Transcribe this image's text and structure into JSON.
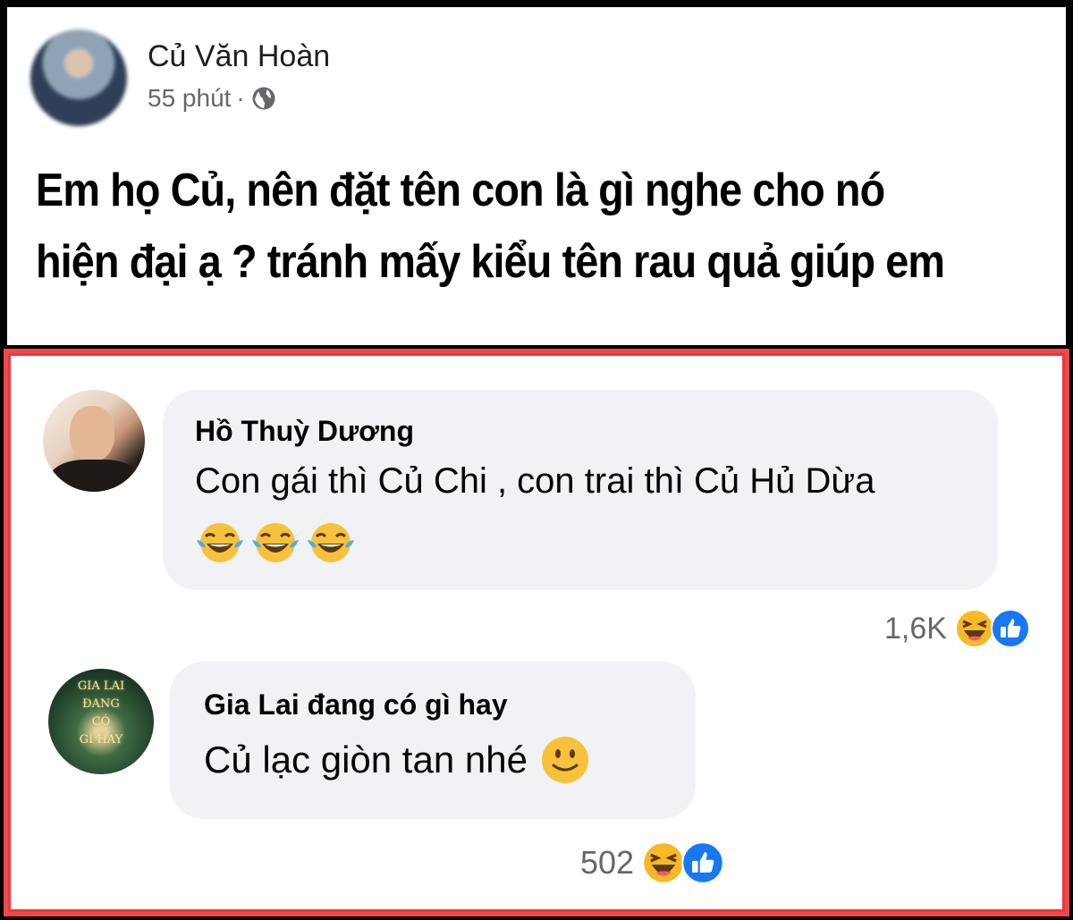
{
  "post": {
    "author": "Củ Văn Hoàn",
    "time": "55 phút",
    "separator": "·",
    "privacy_icon": "globe-icon",
    "body_line1": "Em họ Củ, nên đặt tên con là gì nghe cho nó",
    "body_line2": "hiện đại ạ ? tránh mấy kiểu tên rau quả giúp em"
  },
  "comments": [
    {
      "author": "Hồ Thuỳ Dương",
      "text": "Con gái thì Củ Chi , con trai thì Củ Hủ Dừa",
      "emojis": [
        "tears-of-joy-icon",
        "tears-of-joy-icon",
        "tears-of-joy-icon"
      ],
      "reaction_count": "1,6K",
      "reaction_icons": [
        "haha-icon",
        "like-icon"
      ]
    },
    {
      "author": "Gia Lai đang có gì hay",
      "avatar_text": [
        "GIA LAI",
        "ĐANG",
        "CÓ",
        "GÌ HAY"
      ],
      "text": "Củ lạc giòn tan nhé",
      "emoji": "slightly-smiling-icon",
      "reaction_count": "502",
      "reaction_icons": [
        "haha-icon",
        "like-icon"
      ]
    }
  ],
  "colors": {
    "highlight_border": "#f0474b",
    "bubble_bg": "#f0f2f5",
    "meta_text": "#65676b",
    "like_blue": "#1877f2",
    "haha_yellow": "#f7b928"
  }
}
